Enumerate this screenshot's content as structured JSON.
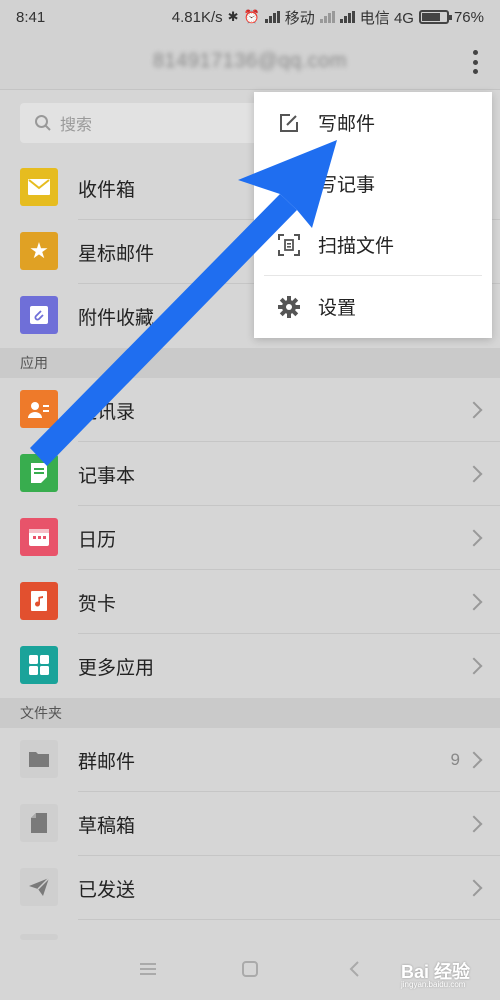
{
  "status_bar": {
    "time": "8:41",
    "speed": "4.81K/s",
    "carrier1": "移动",
    "carrier2": "电信 4G",
    "battery": "76%"
  },
  "header": {
    "account": "814917136@qq.com"
  },
  "search": {
    "placeholder": "搜索"
  },
  "mailboxes": [
    {
      "label": "收件箱",
      "icon": "inbox-icon",
      "color": "#e6bc1f"
    },
    {
      "label": "星标邮件",
      "icon": "star-icon",
      "color": "#e0a124"
    },
    {
      "label": "附件收藏",
      "icon": "attachment-icon",
      "color": "#6f6fd8"
    }
  ],
  "apps_section": {
    "title": "应用",
    "items": [
      {
        "label": "通讯录",
        "icon": "contacts-icon",
        "color": "#ee7a2a"
      },
      {
        "label": "记事本",
        "icon": "notepad-icon",
        "color": "#38ad4e"
      },
      {
        "label": "日历",
        "icon": "calendar-icon",
        "color": "#e8536a"
      },
      {
        "label": "贺卡",
        "icon": "card-icon",
        "color": "#e2502f"
      },
      {
        "label": "更多应用",
        "icon": "grid-icon",
        "color": "#1aa39a"
      }
    ]
  },
  "folders_section": {
    "title": "文件夹",
    "items": [
      {
        "label": "群邮件",
        "icon": "folder-icon",
        "count": "9"
      },
      {
        "label": "草稿箱",
        "icon": "draft-icon",
        "count": ""
      },
      {
        "label": "已发送",
        "icon": "send-icon",
        "count": ""
      }
    ]
  },
  "menu": {
    "items": [
      {
        "label": "写邮件",
        "icon": "compose-icon"
      },
      {
        "label": "写记事",
        "icon": "plus-icon"
      },
      {
        "label": "扫描文件",
        "icon": "scan-icon"
      },
      {
        "label": "设置",
        "icon": "gear-icon"
      }
    ]
  },
  "annotation": {
    "arrow_color": "#1f6ef0"
  },
  "watermark": {
    "brand": "Bai 经验",
    "url": "jingyan.baidu.com"
  }
}
